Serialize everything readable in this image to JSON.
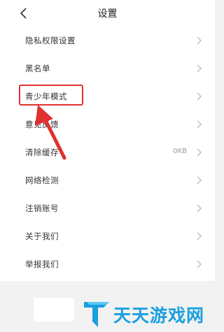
{
  "header": {
    "title": "设置",
    "back_icon": "chevron-left-icon"
  },
  "menu": [
    {
      "label": "隐私权限设置",
      "value": ""
    },
    {
      "label": "黑名单",
      "value": ""
    },
    {
      "label": "青少年模式",
      "value": ""
    },
    {
      "label": "意见反馈",
      "value": ""
    },
    {
      "label": "清除缓存",
      "value": "0KB"
    },
    {
      "label": "网络检测",
      "value": ""
    },
    {
      "label": "注销账号",
      "value": ""
    },
    {
      "label": "关于我们",
      "value": ""
    },
    {
      "label": "举报我们",
      "value": ""
    }
  ],
  "annotation": {
    "color": "#e03030"
  },
  "watermark": {
    "text": "天天游戏网",
    "color": "#1a9fe0"
  }
}
